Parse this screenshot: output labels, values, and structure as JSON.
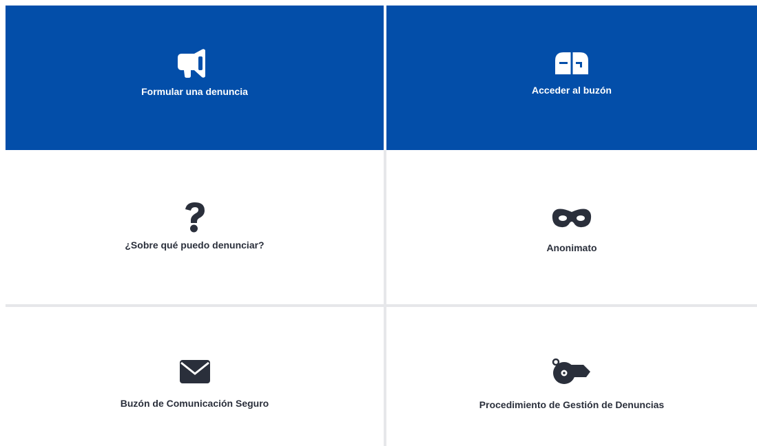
{
  "colors": {
    "primary_tile_bg": "#034ea9",
    "secondary_tile_bg": "#ffffff",
    "icon_dark": "#2a2f3b",
    "divider": "#e6e7ea"
  },
  "tiles": [
    {
      "label": "Formular una denuncia",
      "icon": "megaphone-icon"
    },
    {
      "label": "Acceder al buzón",
      "icon": "mailbox-icon"
    },
    {
      "label": "¿Sobre qué puedo denunciar?",
      "icon": "question-mark-icon"
    },
    {
      "label": "Anonimato",
      "icon": "mask-icon"
    },
    {
      "label": "Buzón de Comunicación Seguro",
      "icon": "envelope-icon"
    },
    {
      "label": "Procedimiento de Gestión de Denuncias",
      "icon": "whistle-icon"
    }
  ]
}
